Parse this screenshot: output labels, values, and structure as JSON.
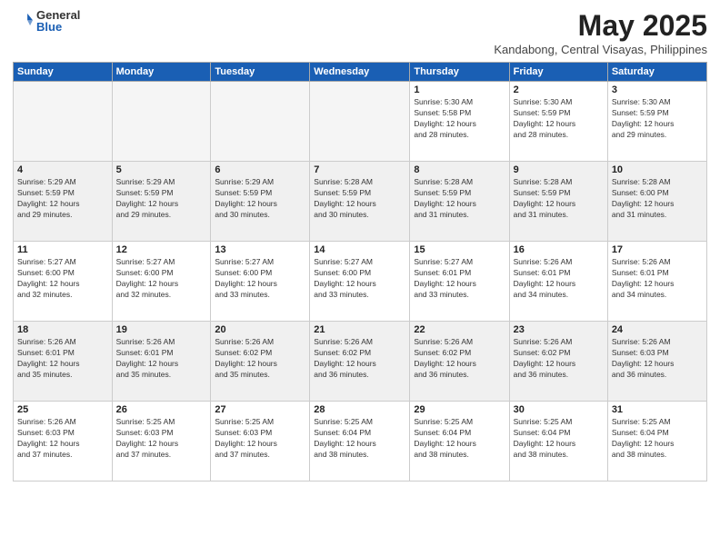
{
  "logo": {
    "general": "General",
    "blue": "Blue"
  },
  "title": {
    "month": "May 2025",
    "location": "Kandabong, Central Visayas, Philippines"
  },
  "headers": [
    "Sunday",
    "Monday",
    "Tuesday",
    "Wednesday",
    "Thursday",
    "Friday",
    "Saturday"
  ],
  "weeks": [
    [
      {
        "day": "",
        "info": ""
      },
      {
        "day": "",
        "info": ""
      },
      {
        "day": "",
        "info": ""
      },
      {
        "day": "",
        "info": ""
      },
      {
        "day": "1",
        "info": "Sunrise: 5:30 AM\nSunset: 5:58 PM\nDaylight: 12 hours\nand 28 minutes."
      },
      {
        "day": "2",
        "info": "Sunrise: 5:30 AM\nSunset: 5:59 PM\nDaylight: 12 hours\nand 28 minutes."
      },
      {
        "day": "3",
        "info": "Sunrise: 5:30 AM\nSunset: 5:59 PM\nDaylight: 12 hours\nand 29 minutes."
      }
    ],
    [
      {
        "day": "4",
        "info": "Sunrise: 5:29 AM\nSunset: 5:59 PM\nDaylight: 12 hours\nand 29 minutes."
      },
      {
        "day": "5",
        "info": "Sunrise: 5:29 AM\nSunset: 5:59 PM\nDaylight: 12 hours\nand 29 minutes."
      },
      {
        "day": "6",
        "info": "Sunrise: 5:29 AM\nSunset: 5:59 PM\nDaylight: 12 hours\nand 30 minutes."
      },
      {
        "day": "7",
        "info": "Sunrise: 5:28 AM\nSunset: 5:59 PM\nDaylight: 12 hours\nand 30 minutes."
      },
      {
        "day": "8",
        "info": "Sunrise: 5:28 AM\nSunset: 5:59 PM\nDaylight: 12 hours\nand 31 minutes."
      },
      {
        "day": "9",
        "info": "Sunrise: 5:28 AM\nSunset: 5:59 PM\nDaylight: 12 hours\nand 31 minutes."
      },
      {
        "day": "10",
        "info": "Sunrise: 5:28 AM\nSunset: 6:00 PM\nDaylight: 12 hours\nand 31 minutes."
      }
    ],
    [
      {
        "day": "11",
        "info": "Sunrise: 5:27 AM\nSunset: 6:00 PM\nDaylight: 12 hours\nand 32 minutes."
      },
      {
        "day": "12",
        "info": "Sunrise: 5:27 AM\nSunset: 6:00 PM\nDaylight: 12 hours\nand 32 minutes."
      },
      {
        "day": "13",
        "info": "Sunrise: 5:27 AM\nSunset: 6:00 PM\nDaylight: 12 hours\nand 33 minutes."
      },
      {
        "day": "14",
        "info": "Sunrise: 5:27 AM\nSunset: 6:00 PM\nDaylight: 12 hours\nand 33 minutes."
      },
      {
        "day": "15",
        "info": "Sunrise: 5:27 AM\nSunset: 6:01 PM\nDaylight: 12 hours\nand 33 minutes."
      },
      {
        "day": "16",
        "info": "Sunrise: 5:26 AM\nSunset: 6:01 PM\nDaylight: 12 hours\nand 34 minutes."
      },
      {
        "day": "17",
        "info": "Sunrise: 5:26 AM\nSunset: 6:01 PM\nDaylight: 12 hours\nand 34 minutes."
      }
    ],
    [
      {
        "day": "18",
        "info": "Sunrise: 5:26 AM\nSunset: 6:01 PM\nDaylight: 12 hours\nand 35 minutes."
      },
      {
        "day": "19",
        "info": "Sunrise: 5:26 AM\nSunset: 6:01 PM\nDaylight: 12 hours\nand 35 minutes."
      },
      {
        "day": "20",
        "info": "Sunrise: 5:26 AM\nSunset: 6:02 PM\nDaylight: 12 hours\nand 35 minutes."
      },
      {
        "day": "21",
        "info": "Sunrise: 5:26 AM\nSunset: 6:02 PM\nDaylight: 12 hours\nand 36 minutes."
      },
      {
        "day": "22",
        "info": "Sunrise: 5:26 AM\nSunset: 6:02 PM\nDaylight: 12 hours\nand 36 minutes."
      },
      {
        "day": "23",
        "info": "Sunrise: 5:26 AM\nSunset: 6:02 PM\nDaylight: 12 hours\nand 36 minutes."
      },
      {
        "day": "24",
        "info": "Sunrise: 5:26 AM\nSunset: 6:03 PM\nDaylight: 12 hours\nand 36 minutes."
      }
    ],
    [
      {
        "day": "25",
        "info": "Sunrise: 5:26 AM\nSunset: 6:03 PM\nDaylight: 12 hours\nand 37 minutes."
      },
      {
        "day": "26",
        "info": "Sunrise: 5:25 AM\nSunset: 6:03 PM\nDaylight: 12 hours\nand 37 minutes."
      },
      {
        "day": "27",
        "info": "Sunrise: 5:25 AM\nSunset: 6:03 PM\nDaylight: 12 hours\nand 37 minutes."
      },
      {
        "day": "28",
        "info": "Sunrise: 5:25 AM\nSunset: 6:04 PM\nDaylight: 12 hours\nand 38 minutes."
      },
      {
        "day": "29",
        "info": "Sunrise: 5:25 AM\nSunset: 6:04 PM\nDaylight: 12 hours\nand 38 minutes."
      },
      {
        "day": "30",
        "info": "Sunrise: 5:25 AM\nSunset: 6:04 PM\nDaylight: 12 hours\nand 38 minutes."
      },
      {
        "day": "31",
        "info": "Sunrise: 5:25 AM\nSunset: 6:04 PM\nDaylight: 12 hours\nand 38 minutes."
      }
    ]
  ]
}
